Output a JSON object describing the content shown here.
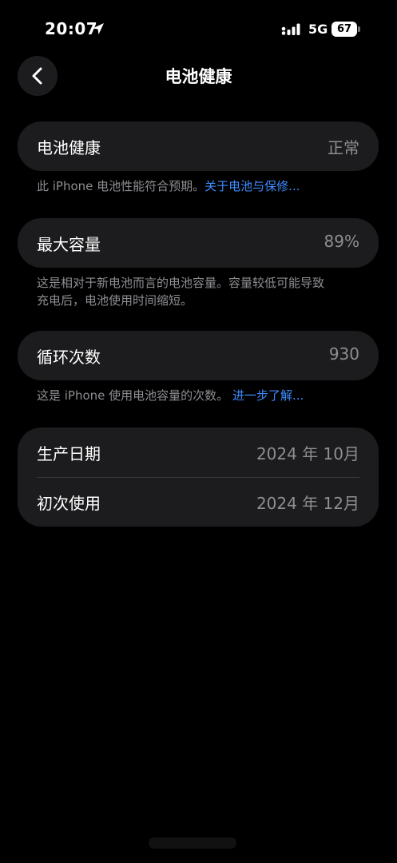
{
  "status_bar": {
    "time": "20:07",
    "network": "5G",
    "battery_level": "67",
    "icons": [
      "location-arrow-icon",
      "signal-icon",
      "battery-icon"
    ]
  },
  "header": {
    "back_icon": "chevron-left-icon",
    "title": "电池健康"
  },
  "battery_health": {
    "label": "电池健康",
    "value": "正常",
    "note_text": "此 iPhone 电池性能符合预期。",
    "note_link": "关于电池与保修..."
  },
  "max_capacity": {
    "label": "最大容量",
    "value": "89%",
    "note_line1": "这是相对于新电池而言的电池容量。容量较低可能导致",
    "note_line2": "充电后，电池使用时间缩短。"
  },
  "cycle_count": {
    "label": "循环次数",
    "value": "930",
    "note_text": "这是 iPhone 使用电池容量的次数。",
    "note_link": "进一步了解..."
  },
  "dates": {
    "manufacture_label": "生产日期",
    "manufacture_value": "2024 年 10月",
    "first_use_label": "初次使用",
    "first_use_value": "2024 年 12月"
  },
  "colors": {
    "background": "#000000",
    "card": "#1c1c1e",
    "secondary_text": "#8e8e93",
    "link": "#3e8cff"
  }
}
